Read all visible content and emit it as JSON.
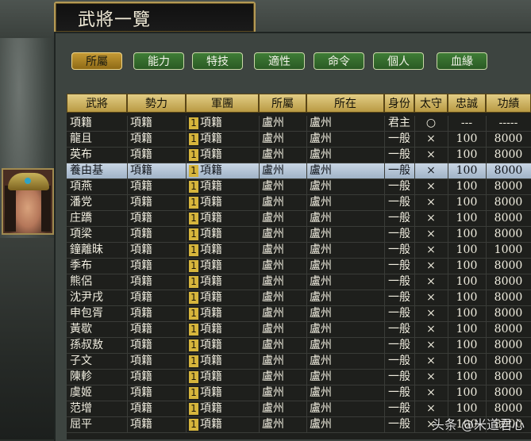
{
  "window": {
    "title": "武將一覽"
  },
  "tabs": [
    {
      "label": "所屬",
      "active": true
    },
    {
      "label": "能力",
      "active": false
    },
    {
      "label": "特技",
      "active": false
    },
    {
      "label": "適性",
      "active": false
    },
    {
      "label": "命令",
      "active": false
    },
    {
      "label": "個人",
      "active": false
    },
    {
      "label": "血緣",
      "active": false
    }
  ],
  "table": {
    "headers": [
      "武將",
      "勢力",
      "軍團",
      "所屬",
      "所在",
      "身份",
      "太守",
      "忠誠",
      "功績"
    ],
    "rows": [
      [
        "項籍",
        "項籍",
        "1",
        "項籍",
        "盧州",
        "盧州",
        "君主",
        "○",
        "---",
        "-----"
      ],
      [
        "龍且",
        "項籍",
        "1",
        "項籍",
        "盧州",
        "盧州",
        "一般",
        "×",
        "100",
        "8000"
      ],
      [
        "英布",
        "項籍",
        "1",
        "項籍",
        "盧州",
        "盧州",
        "一般",
        "×",
        "100",
        "8000"
      ],
      [
        "養由基",
        "項籍",
        "1",
        "項籍",
        "盧州",
        "盧州",
        "一般",
        "×",
        "100",
        "8000"
      ],
      [
        "項燕",
        "項籍",
        "1",
        "項籍",
        "盧州",
        "盧州",
        "一般",
        "×",
        "100",
        "8000"
      ],
      [
        "潘党",
        "項籍",
        "1",
        "項籍",
        "盧州",
        "盧州",
        "一般",
        "×",
        "100",
        "8000"
      ],
      [
        "庄蹻",
        "項籍",
        "1",
        "項籍",
        "盧州",
        "盧州",
        "一般",
        "×",
        "100",
        "8000"
      ],
      [
        "項梁",
        "項籍",
        "1",
        "項籍",
        "盧州",
        "盧州",
        "一般",
        "×",
        "100",
        "8000"
      ],
      [
        "鐘離昧",
        "項籍",
        "1",
        "項籍",
        "盧州",
        "盧州",
        "一般",
        "×",
        "100",
        "1000"
      ],
      [
        "季布",
        "項籍",
        "1",
        "項籍",
        "盧州",
        "盧州",
        "一般",
        "×",
        "100",
        "8000"
      ],
      [
        "熊侶",
        "項籍",
        "1",
        "項籍",
        "盧州",
        "盧州",
        "一般",
        "×",
        "100",
        "8000"
      ],
      [
        "沈尹戌",
        "項籍",
        "1",
        "項籍",
        "盧州",
        "盧州",
        "一般",
        "×",
        "100",
        "8000"
      ],
      [
        "申包胥",
        "項籍",
        "1",
        "項籍",
        "盧州",
        "盧州",
        "一般",
        "×",
        "100",
        "8000"
      ],
      [
        "黃歇",
        "項籍",
        "1",
        "項籍",
        "盧州",
        "盧州",
        "一般",
        "×",
        "100",
        "8000"
      ],
      [
        "孫叔敖",
        "項籍",
        "1",
        "項籍",
        "盧州",
        "盧州",
        "一般",
        "×",
        "100",
        "8000"
      ],
      [
        "子文",
        "項籍",
        "1",
        "項籍",
        "盧州",
        "盧州",
        "一般",
        "×",
        "100",
        "8000"
      ],
      [
        "陳軫",
        "項籍",
        "1",
        "項籍",
        "盧州",
        "盧州",
        "一般",
        "×",
        "100",
        "8000"
      ],
      [
        "虞姬",
        "項籍",
        "1",
        "項籍",
        "盧州",
        "盧州",
        "一般",
        "×",
        "100",
        "8000"
      ],
      [
        "范增",
        "項籍",
        "1",
        "項籍",
        "盧州",
        "盧州",
        "一般",
        "×",
        "100",
        "8000"
      ],
      [
        "屈平",
        "項籍",
        "1",
        "項籍",
        "盧州",
        "盧州",
        "一般",
        "×",
        "100",
        "8000"
      ]
    ],
    "selected_row": 3
  },
  "watermark": "头条 @米道君心",
  "colors": {
    "tab_active": "#c49a35",
    "tab_inactive": "#3f7d36",
    "header_gold": "#d4bb6a",
    "selected_row": "#b8c8d8"
  }
}
